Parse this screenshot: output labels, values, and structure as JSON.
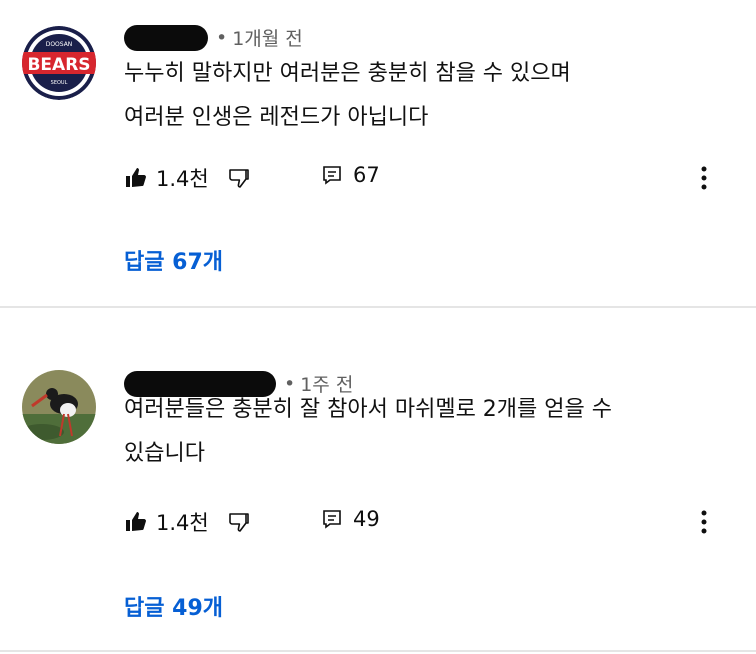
{
  "comments": [
    {
      "time": "1개월 전",
      "text_lines": [
        "누누히 말하지만 여러분은 충분히 참을 수 있으며",
        "여러분 인생은 레전드가 아닙니다"
      ],
      "likes": "1.4천",
      "reply_count": "67",
      "reply_button": "답글 67개",
      "avatar": {
        "type": "team-logo",
        "text": "BEARS",
        "top_text": "DOOSAN",
        "bottom_text": "SEOUL"
      }
    },
    {
      "time": "1주 전",
      "text_lines": [
        "여러분들은 충분히 잘 참아서 마쉬멜로 2개를 얻을 수",
        "있습니다"
      ],
      "likes": "1.4천",
      "reply_count": "49",
      "reply_button": "답글 49개",
      "avatar": {
        "type": "bird-photo"
      }
    }
  ],
  "colors": {
    "link": "#065fd4",
    "meta": "#606060",
    "divider": "#e5e5e5"
  },
  "icons": [
    "thumb-up-icon",
    "thumb-down-icon",
    "comment-icon",
    "more-vert-icon"
  ]
}
